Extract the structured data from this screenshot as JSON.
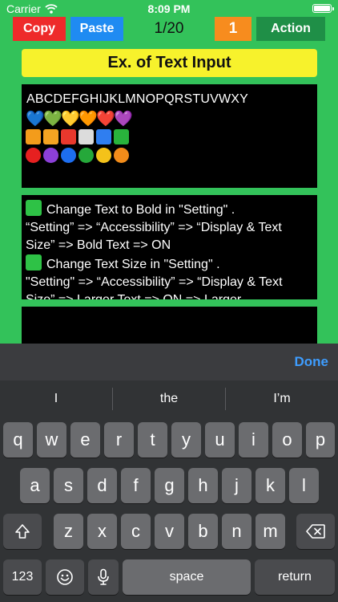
{
  "status": {
    "carrier": "Carrier",
    "time": "8:09 PM"
  },
  "toolbar": {
    "copy_label": "Copy",
    "paste_label": "Paste",
    "counter": "1/20",
    "one_label": "1",
    "action_label": "Action"
  },
  "title": "Ex. of Text Input",
  "panel1": {
    "alphabet": "ABCDEFGHIJKLMNOPQRSTUVWXY",
    "hearts": [
      "💙",
      "💚",
      "💛",
      "🧡",
      "❤️",
      "💜"
    ],
    "square_colors": [
      "#f39c1b",
      "#f5a422",
      "#e8382d",
      "#dcdcdc",
      "#2f7ef0",
      "#29b33c"
    ],
    "circle_colors": [
      "#e62020",
      "#8c3fd8",
      "#1d6ef0",
      "#25a83a",
      "#f4c21a",
      "#f28c1a"
    ]
  },
  "panel2": {
    "line1": "Change Text to Bold in \"Setting\" .",
    "line2": "“Setting” => “Accessibility” => “Display & Text Size” => Bold Text => ON",
    "line3": "Change Text Size in \"Setting\" .",
    "line4": " \"Setting\" => “Accessibility” => “Display & Text Size” => Larger Text => ON  =>  Larger"
  },
  "keyboard": {
    "done_label": "Done",
    "suggestions": [
      "I",
      "the",
      "I’m"
    ],
    "row1": [
      "q",
      "w",
      "e",
      "r",
      "t",
      "y",
      "u",
      "i",
      "o",
      "p"
    ],
    "row2": [
      "a",
      "s",
      "d",
      "f",
      "g",
      "h",
      "j",
      "k",
      "l"
    ],
    "row3": [
      "z",
      "x",
      "c",
      "v",
      "b",
      "n",
      "m"
    ],
    "numbers_label": "123",
    "space_label": "space",
    "return_label": "return"
  }
}
